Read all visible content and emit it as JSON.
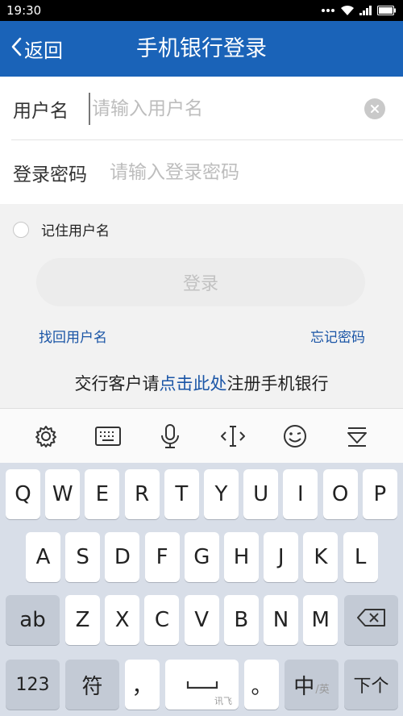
{
  "status_bar": {
    "time": "19:30"
  },
  "nav": {
    "back_label": "返回",
    "title": "手机银行登录"
  },
  "form": {
    "username_label": "用户名",
    "username_placeholder": "请输入用户名",
    "password_label": "登录密码",
    "password_placeholder": "请输入登录密码"
  },
  "remember_label": "记住用户名",
  "login_button": "登录",
  "links": {
    "retrieve_username": "找回用户名",
    "forgot_password": "忘记密码"
  },
  "register": {
    "prefix": "交行客户请",
    "link": "点击此处",
    "suffix": "注册手机银行"
  },
  "keyboard_toolbar": [
    "gear-icon",
    "keyboard-icon",
    "microphone-icon",
    "cursor-icon",
    "emoji-icon",
    "collapse-keyboard-icon"
  ],
  "keyboard": {
    "row1": [
      "Q",
      "W",
      "E",
      "R",
      "T",
      "Y",
      "U",
      "I",
      "O",
      "P"
    ],
    "row2": [
      "A",
      "S",
      "D",
      "F",
      "G",
      "H",
      "J",
      "K",
      "L"
    ],
    "row3": [
      "Z",
      "X",
      "C",
      "V",
      "B",
      "N",
      "M"
    ],
    "shift_label": "ab",
    "numbers_label": "123",
    "symbols_label": "符",
    "comma_label": "，",
    "space_sub_label": "讯飞",
    "period_label": "。",
    "lang_main": "中",
    "lang_sub": "/英",
    "next_label": "下个"
  },
  "colors": {
    "primary": "#1a63b8",
    "link": "#1a55a6"
  }
}
